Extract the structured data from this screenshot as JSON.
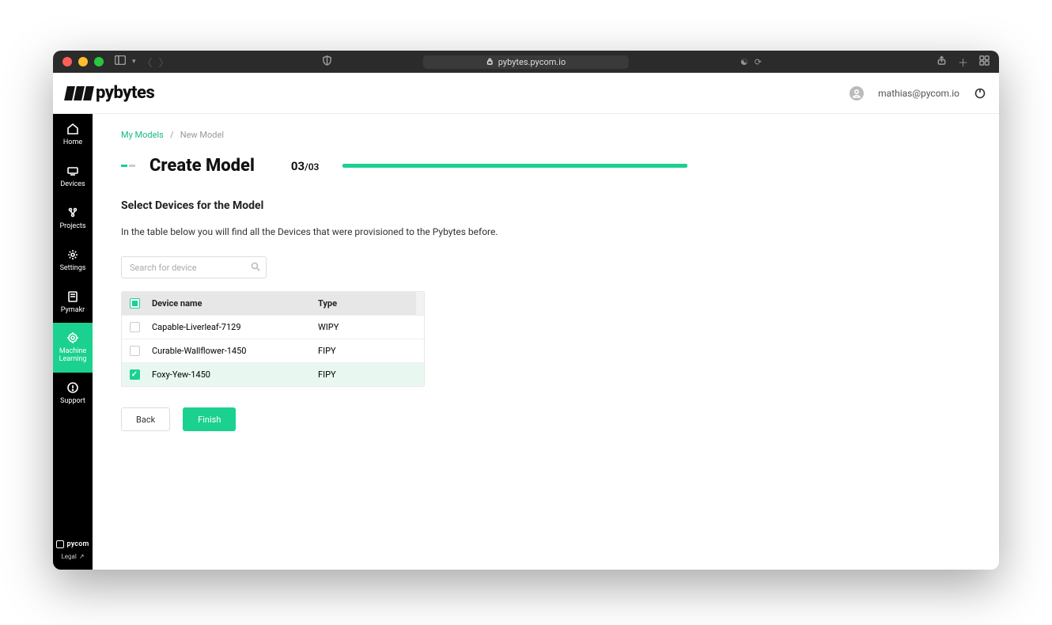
{
  "browser": {
    "url": "pybytes.pycom.io"
  },
  "header": {
    "logo_text": "pybytes",
    "user_email": "mathias@pycom.io"
  },
  "sidebar": {
    "items": [
      {
        "label": "Home"
      },
      {
        "label": "Devices"
      },
      {
        "label": "Projects"
      },
      {
        "label": "Settings"
      },
      {
        "label": "Pymakr"
      },
      {
        "label": "Machine Learning"
      },
      {
        "label": "Support"
      }
    ],
    "footer_brand": "pycom",
    "footer_legal": "Legal"
  },
  "breadcrumb": {
    "root": "My Models",
    "sep": "/",
    "current": "New Model"
  },
  "page": {
    "title": "Create Model",
    "step_current": "03",
    "step_total": "/03",
    "section_title": "Select Devices for the Model",
    "description": "In the table below you will find all the Devices that were provisioned to the Pybytes before."
  },
  "search": {
    "placeholder": "Search for device"
  },
  "table": {
    "col_name": "Device name",
    "col_type": "Type",
    "rows": [
      {
        "name": "Capable-Liverleaf-7129",
        "type": "WIPY"
      },
      {
        "name": "Curable-Wallflower-1450",
        "type": "FIPY"
      },
      {
        "name": "Foxy-Yew-1450",
        "type": "FIPY"
      }
    ]
  },
  "buttons": {
    "back": "Back",
    "finish": "Finish"
  }
}
